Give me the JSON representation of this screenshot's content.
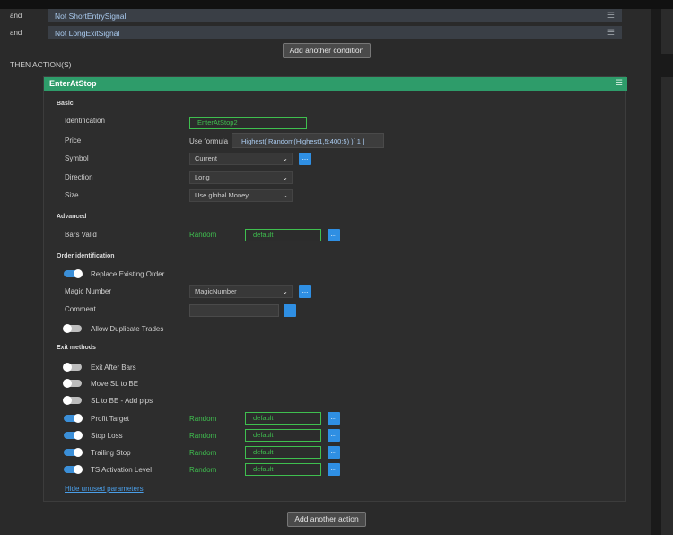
{
  "conditions": [
    {
      "connector": "and",
      "text": "Not ShortEntrySignal"
    },
    {
      "connector": "and",
      "text": "Not LongExitSignal"
    }
  ],
  "add_condition_label": "Add another condition",
  "then_actions_label": "THEN ACTION(S)",
  "menu_icon": "☰",
  "action": {
    "title": "EnterAtStop",
    "sections": {
      "basic": "Basic",
      "advanced": "Advanced",
      "order_identification": "Order identification",
      "exit_methods": "Exit methods"
    },
    "identification": {
      "label": "Identification",
      "value": "EnterAtStop2"
    },
    "price": {
      "label": "Price",
      "mode": "Use formula",
      "formula": "Highest( Random(Highest1,5:400:5) )[ 1 ]"
    },
    "symbol": {
      "label": "Symbol",
      "value": "Current"
    },
    "direction": {
      "label": "Direction",
      "value": "Long"
    },
    "size": {
      "label": "Size",
      "value": "Use  global  Money"
    },
    "bars_valid": {
      "label": "Bars Valid",
      "mode": "Random",
      "value": "default"
    },
    "replace_existing": {
      "label": "Replace Existing Order",
      "on": true
    },
    "magic_number": {
      "label": "Magic Number",
      "value": "MagicNumber"
    },
    "comment": {
      "label": "Comment",
      "value": ""
    },
    "allow_duplicate": {
      "label": "Allow Duplicate Trades",
      "on": false
    },
    "exit_after_bars": {
      "label": "Exit After Bars",
      "on": false
    },
    "move_sl_be": {
      "label": "Move SL to BE",
      "on": false
    },
    "sl_be_pips": {
      "label": "SL to BE - Add pips",
      "on": false
    },
    "profit_target": {
      "label": "Profit Target",
      "on": true,
      "mode": "Random",
      "value": "default"
    },
    "stop_loss": {
      "label": "Stop Loss",
      "on": true,
      "mode": "Random",
      "value": "default"
    },
    "trailing_stop": {
      "label": "Trailing Stop",
      "on": true,
      "mode": "Random",
      "value": "default"
    },
    "ts_activation": {
      "label": "TS Activation Level",
      "on": true,
      "mode": "Random",
      "value": "default"
    },
    "hide_unused": "Hide unused parameters",
    "dots": "...",
    "chevron": "⌄"
  },
  "add_action_label": "Add another action"
}
